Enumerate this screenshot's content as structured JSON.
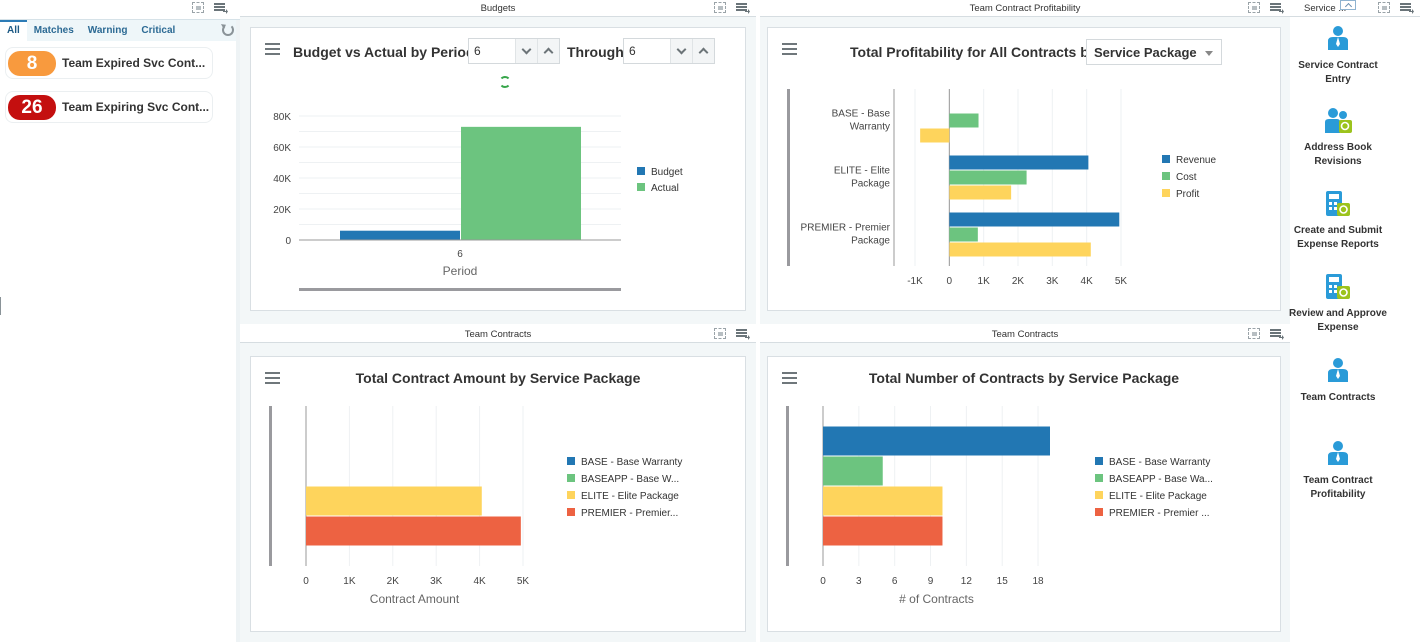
{
  "watchlist": {
    "tabs": [
      {
        "label": "All",
        "active": true
      },
      {
        "label": "Matches",
        "active": false
      },
      {
        "label": "Warning",
        "active": false
      },
      {
        "label": "Critical",
        "active": false
      }
    ],
    "items": [
      {
        "count": "8",
        "label": "Team Expired Svc Cont...",
        "color": "#f89a3e"
      },
      {
        "count": "26",
        "label": "Team Expiring Svc Cont...",
        "color": "#c40f0f"
      }
    ]
  },
  "panes": {
    "budgets": {
      "header": "Budgets"
    },
    "profitability": {
      "header": "Team Contract Profitability"
    },
    "contracts_amount": {
      "header": "Team Contracts"
    },
    "contracts_count": {
      "header": "Team Contracts"
    },
    "springboard": {
      "header": "Service ..."
    }
  },
  "budget_card": {
    "title": "Budget vs Actual by Period",
    "from_period": "6",
    "through_label": "Through",
    "through_period": "6"
  },
  "profit_card": {
    "title": "Total Profitability for All Contracts by",
    "group_by": "Service Package"
  },
  "amount_card": {
    "title": "Total Contract Amount by Service Package"
  },
  "count_card": {
    "title": "Total Number of Contracts by Service Package"
  },
  "colors": {
    "blue": "#2277b3",
    "green": "#6cc47f",
    "yellow": "#fed45c",
    "red": "#ed6242"
  },
  "springboard": {
    "tiles": [
      {
        "label": "Service Contract Entry",
        "icon": "person-icon"
      },
      {
        "label": "Address Book Revisions",
        "icon": "people-edit-icon"
      },
      {
        "label": "Create and Submit Expense Reports",
        "icon": "calculator-edit-icon"
      },
      {
        "label": "Review and Approve Expense",
        "icon": "calculator-edit-icon"
      },
      {
        "label": "Team Contracts",
        "icon": "person-icon"
      },
      {
        "label": "Team Contract Profitability",
        "icon": "person-icon"
      }
    ]
  },
  "chart_data": [
    {
      "type": "bar",
      "title": "Budget vs Actual by Period",
      "orientation": "vertical",
      "categories": [
        "6"
      ],
      "series": [
        {
          "name": "Budget",
          "values": [
            6000
          ]
        },
        {
          "name": "Actual",
          "values": [
            73000
          ]
        }
      ],
      "xlabel": "Period",
      "ylabel": "",
      "ylim": [
        0,
        80000
      ],
      "yticks": [
        "0",
        "20K",
        "40K",
        "60K",
        "80K"
      ],
      "yticks_values": [
        0,
        20000,
        40000,
        60000,
        80000
      ],
      "legend": "right",
      "grid": true
    },
    {
      "type": "bar",
      "title": "Total Profitability for All Contracts by Service Package",
      "orientation": "horizontal",
      "categories": [
        "BASE - Base Warranty",
        "ELITE - Elite Package",
        "PREMIER - Premier Package"
      ],
      "category_lines": [
        [
          "BASE - Base",
          "Warranty"
        ],
        [
          "ELITE - Elite",
          "Package"
        ],
        [
          "PREMIER - Premier",
          "Package"
        ]
      ],
      "series": [
        {
          "name": "Revenue",
          "values": [
            0,
            4050,
            4950
          ]
        },
        {
          "name": "Cost",
          "values": [
            850,
            2250,
            830
          ]
        },
        {
          "name": "Profit",
          "values": [
            -850,
            1800,
            4120
          ]
        }
      ],
      "xlabel": "",
      "xlim": [
        -1000,
        5000
      ],
      "xticks": [
        "-1K",
        "0",
        "1K",
        "2K",
        "3K",
        "4K",
        "5K"
      ],
      "xticks_values": [
        -1000,
        0,
        1000,
        2000,
        3000,
        4000,
        5000
      ],
      "legend": "right",
      "grid": true
    },
    {
      "type": "bar",
      "title": "Total Contract Amount by Service Package",
      "orientation": "horizontal",
      "categories": [
        ""
      ],
      "series": [
        {
          "name": "BASE - Base Warranty",
          "values": [
            0
          ]
        },
        {
          "name": "BASEAPP - Base W...",
          "values": [
            0
          ]
        },
        {
          "name": "ELITE - Elite Package",
          "values": [
            4050
          ]
        },
        {
          "name": "PREMIER - Premier...",
          "values": [
            4950
          ]
        }
      ],
      "xlabel": "Contract Amount",
      "xlim": [
        0,
        5000
      ],
      "xticks": [
        "0",
        "1K",
        "2K",
        "3K",
        "4K",
        "5K"
      ],
      "xticks_values": [
        0,
        1000,
        2000,
        3000,
        4000,
        5000
      ],
      "legend": "right",
      "grid": true
    },
    {
      "type": "bar",
      "title": "Total Number of Contracts by Service Package",
      "orientation": "horizontal",
      "categories": [
        ""
      ],
      "series": [
        {
          "name": "BASE - Base Warranty",
          "values": [
            19
          ]
        },
        {
          "name": "BASEAPP - Base Wa...",
          "values": [
            5
          ]
        },
        {
          "name": "ELITE - Elite Package",
          "values": [
            10
          ]
        },
        {
          "name": "PREMIER - Premier ...",
          "values": [
            10
          ]
        }
      ],
      "xlabel": "# of Contracts",
      "xlim": [
        0,
        19
      ],
      "xticks": [
        "0",
        "3",
        "6",
        "9",
        "12",
        "15",
        "18"
      ],
      "xticks_values": [
        0,
        3,
        6,
        9,
        12,
        15,
        18
      ],
      "legend": "right",
      "grid": true
    }
  ]
}
